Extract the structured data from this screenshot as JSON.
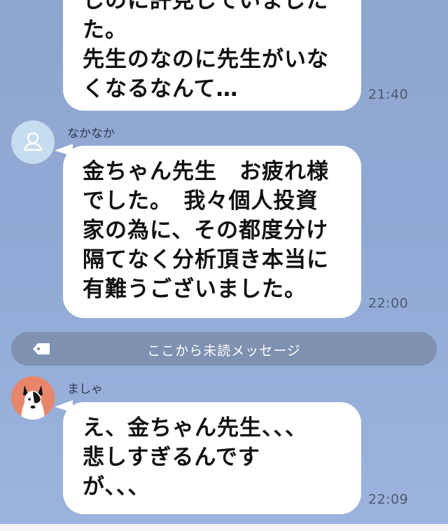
{
  "messages": [
    {
      "lines": [
        "しのに許見していました",
        "た。",
        "先生のなのに先生がいな",
        "くなるなんて…"
      ],
      "time": "21:40"
    },
    {
      "sender": "なかなか",
      "lines": [
        "金ちゃん先生　お疲れ様",
        "でした。　我々個人投資",
        "家の為に、その都度分け",
        "隔てなく分析頂き本当に",
        "有難うございました。"
      ],
      "time": "22:00"
    },
    {
      "sender": "ましゃ",
      "lines": [
        "え、金ちゃん先生、、、",
        "悲しすぎるんです",
        "が、、、"
      ],
      "time": "22:09"
    }
  ],
  "unread_divider": {
    "label": "ここから未読メッセージ",
    "icon": "tag-icon"
  },
  "icons": {
    "default_avatar": "person-icon",
    "dog_avatar": "dog-avatar-icon"
  },
  "colors": {
    "background": "#90a9d4",
    "bubble": "#ffffff",
    "divider": "#7f91b1",
    "avatar_default": "#c6dcef",
    "avatar_dog": "#e9856b"
  }
}
